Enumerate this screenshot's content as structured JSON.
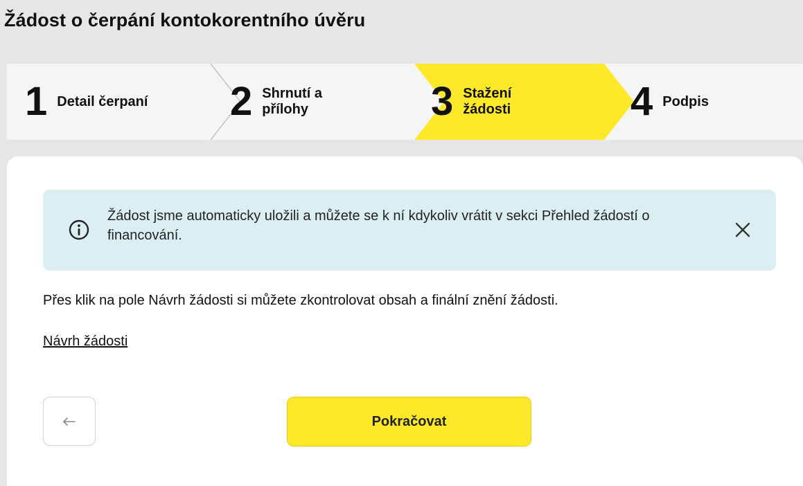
{
  "page": {
    "title": "Žádost o čerpání kontokorentního úvěru"
  },
  "stepper": {
    "active_index": 2,
    "active_color": "#fde829",
    "steps": [
      {
        "number": "1",
        "label_lines": [
          "Detail čerpaní"
        ]
      },
      {
        "number": "2",
        "label_lines": [
          "Shrnutí a",
          "přílohy"
        ]
      },
      {
        "number": "3",
        "label_lines": [
          "Stažení",
          "žádosti"
        ]
      },
      {
        "number": "4",
        "label_lines": [
          "Podpis"
        ]
      }
    ]
  },
  "info_banner": {
    "text": "Žádost jsme automaticky uložili a můžete se k ní kdykoliv vrátit v sekci  Přehled žádostí o financování.",
    "icon": "info-icon",
    "close_icon": "close-icon",
    "background": "#dbeff3"
  },
  "content": {
    "description": "Přes klik na pole Návrh žádosti si můžete zkontrolovat obsah a finální znění žádosti.",
    "link_label": "Návrh žádosti"
  },
  "actions": {
    "back_icon": "arrow-left-icon",
    "continue_label": "Pokračovat",
    "continue_color": "#fde829"
  }
}
